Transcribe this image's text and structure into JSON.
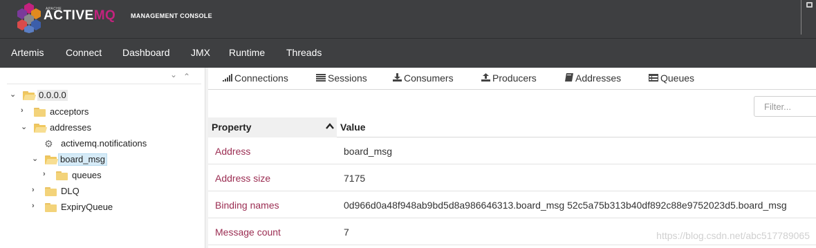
{
  "header": {
    "brand_small": "APACHE",
    "brand_main_a": "ACTIVE",
    "brand_main_b": "MQ",
    "brand_console": "MANAGEMENT CONSOLE",
    "accent": "#c3227e"
  },
  "nav": {
    "items": [
      "Artemis",
      "Connect",
      "Dashboard",
      "JMX",
      "Runtime",
      "Threads"
    ]
  },
  "tree": {
    "collapse_icon": "chevron-down-icon",
    "expand_icon": "chevron-up-icon",
    "nodes": [
      {
        "label": "0.0.0.0",
        "expanded": true,
        "icon": "folder-open-icon"
      },
      {
        "label": "acceptors",
        "expanded": false,
        "icon": "folder-icon"
      },
      {
        "label": "addresses",
        "expanded": true,
        "icon": "folder-open-icon"
      },
      {
        "label": "activemq.notifications",
        "icon": "gear-icon"
      },
      {
        "label": "board_msg",
        "expanded": true,
        "selected": true,
        "icon": "folder-open-icon"
      },
      {
        "label": "queues",
        "expanded": false,
        "icon": "folder-icon"
      },
      {
        "label": "DLQ",
        "expanded": false,
        "icon": "folder-icon"
      },
      {
        "label": "ExpiryQueue",
        "expanded": false,
        "icon": "folder-icon"
      }
    ]
  },
  "tabs": [
    {
      "label": "Connections",
      "icon": "signal-icon"
    },
    {
      "label": "Sessions",
      "icon": "list-icon"
    },
    {
      "label": "Consumers",
      "icon": "download-icon"
    },
    {
      "label": "Producers",
      "icon": "upload-icon"
    },
    {
      "label": "Addresses",
      "icon": "book-icon"
    },
    {
      "label": "Queues",
      "icon": "table-icon"
    }
  ],
  "filter": {
    "placeholder": "Filter..."
  },
  "table": {
    "col_property": "Property",
    "col_value": "Value",
    "rows": [
      {
        "property": "Address",
        "value": "board_msg"
      },
      {
        "property": "Address size",
        "value": "7175"
      },
      {
        "property": "Binding names",
        "value": "0d966d0a48f948ab9bd5d8a986646313.board_msg 52c5a75b313b40df892c88e9752023d5.board_msg"
      },
      {
        "property": "Message count",
        "value": "7"
      }
    ]
  },
  "watermark": "https://blog.csdn.net/abc517789065"
}
